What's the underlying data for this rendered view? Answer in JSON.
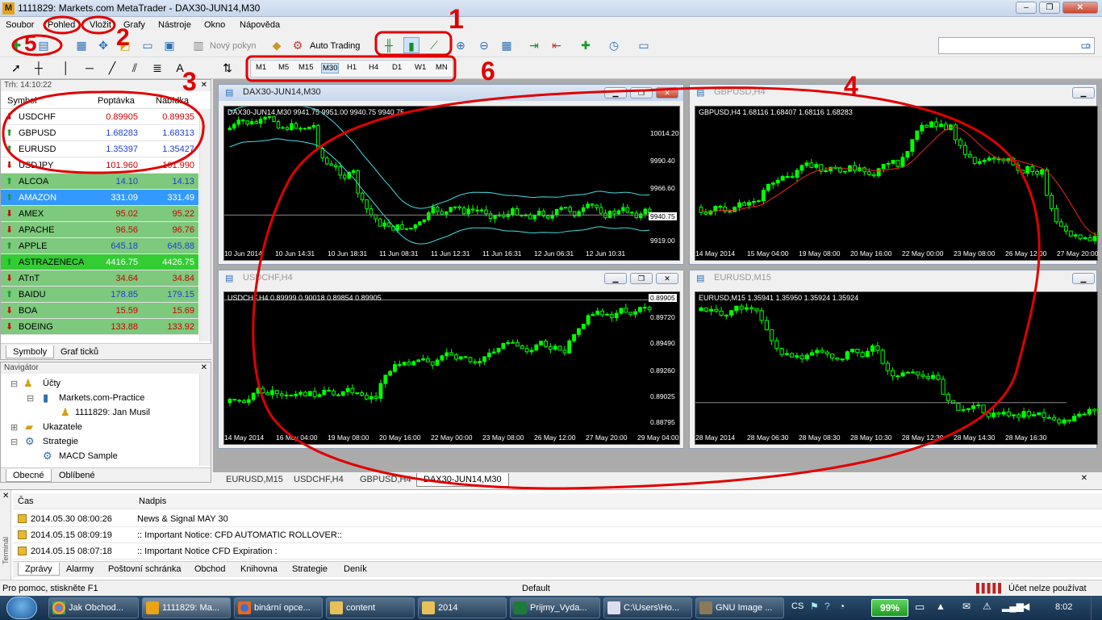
{
  "window": {
    "title": "1111829: Markets.com MetaTrader - DAX30-JUN14,M30",
    "icon_letter": "M"
  },
  "menu": [
    "Soubor",
    "Pohled",
    "Vložit",
    "Grafy",
    "Nástroje",
    "Okno",
    "Nápověda"
  ],
  "toolbar": {
    "new_order": "Nový pokyn",
    "auto_trading": "Auto Trading"
  },
  "timeframes": [
    "M1",
    "M5",
    "M15",
    "M30",
    "H1",
    "H4",
    "D1",
    "W1",
    "MN"
  ],
  "annotations": [
    "1",
    "2",
    "3",
    "4",
    "5",
    "6"
  ],
  "market_watch": {
    "header": "Trh: 14:10:22",
    "columns": {
      "symbol": "Symbol",
      "bid": "Poptávka",
      "ask": "Nabídka"
    },
    "rows": [
      {
        "symbol": "USDCHF",
        "bid": "0.89905",
        "ask": "0.89935",
        "dir": "down"
      },
      {
        "symbol": "GBPUSD",
        "bid": "1.68283",
        "ask": "1.68313",
        "dir": "up"
      },
      {
        "symbol": "EURUSD",
        "bid": "1.35397",
        "ask": "1.35427",
        "dir": "up"
      },
      {
        "symbol": "USDJPY",
        "bid": "101.960",
        "ask": "101.990",
        "dir": "down"
      },
      {
        "symbol": "ALCOA",
        "bid": "14.10",
        "ask": "14.13",
        "dir": "up"
      },
      {
        "symbol": "AMAZON",
        "bid": "331.09",
        "ask": "331.49",
        "dir": "up"
      },
      {
        "symbol": "AMEX",
        "bid": "95.02",
        "ask": "95.22",
        "dir": "down"
      },
      {
        "symbol": "APACHE",
        "bid": "96.56",
        "ask": "96.76",
        "dir": "down"
      },
      {
        "symbol": "APPLE",
        "bid": "645.18",
        "ask": "645.88",
        "dir": "up"
      },
      {
        "symbol": "ASTRAZENECA",
        "bid": "4416.75",
        "ask": "4426.75",
        "dir": "up"
      },
      {
        "symbol": "ATnT",
        "bid": "34.64",
        "ask": "34.84",
        "dir": "down"
      },
      {
        "symbol": "BAIDU",
        "bid": "178.85",
        "ask": "179.15",
        "dir": "up"
      },
      {
        "symbol": "BOA",
        "bid": "15.59",
        "ask": "15.69",
        "dir": "down"
      },
      {
        "symbol": "BOEING",
        "bid": "133.88",
        "ask": "133.92",
        "dir": "down"
      }
    ],
    "tabs": [
      "Symboly",
      "Graf ticků"
    ]
  },
  "navigator": {
    "header": "Navigátor",
    "items": [
      "Účty",
      "Markets.com-Practice",
      "1111829: Jan Musil",
      "Ukazatele",
      "Strategie",
      "MACD Sample"
    ],
    "tabs": [
      "Obecné",
      "Oblíbené"
    ]
  },
  "charts": {
    "dax": {
      "title": "DAX30-JUN14,M30",
      "info": "DAX30-JUN14,M30  9941.75 9951.00 9940.75 9940.75",
      "prices": [
        "10014.20",
        "9990.40",
        "9966.60",
        "9940.75",
        "9919.00"
      ],
      "times": [
        "10 Jun 2014",
        "10 Jun 14:31",
        "10 Jun 18:31",
        "11 Jun 08:31",
        "11 Jun 12:31",
        "11 Jun 16:31",
        "12 Jun 06:31",
        "12 Jun 10:31"
      ]
    },
    "gbpusd": {
      "title": "GBPUSD,H4",
      "info": "GBPUSD,H4  1.68116 1.68407 1.68116 1.68283",
      "times": [
        "14 May 2014",
        "15 May 04:00",
        "19 May 08:00",
        "20 May 16:00",
        "22 May 00:00",
        "23 May 08:00",
        "26 May 12:00",
        "27 May 20:00"
      ]
    },
    "usdchf": {
      "title": "USDCHF,H4",
      "info": "USDCHF,H4  0.89999 0.90018 0.89854 0.89905",
      "prices": [
        "0.89905",
        "0.89720",
        "0.89490",
        "0.89260",
        "0.89025",
        "0.88795"
      ],
      "times": [
        "14 May 2014",
        "16 May 04:00",
        "19 May 08:00",
        "20 May 16:00",
        "22 May 00:00",
        "23 May 08:00",
        "26 May 12:00",
        "27 May 20:00",
        "29 May 04:00"
      ]
    },
    "eurusd": {
      "title": "EURUSD,M15",
      "info": "EURUSD,M15  1.35941 1.35950 1.35924 1.35924",
      "times": [
        "28 May 2014",
        "28 May 06:30",
        "28 May 08:30",
        "28 May 10:30",
        "28 May 12:30",
        "28 May 14:30",
        "28 May 16:30"
      ]
    }
  },
  "chart_tabs": [
    "EURUSD,M15",
    "USDCHF,H4",
    "GBPUSD,H4",
    "DAX30-JUN14,M30"
  ],
  "terminal": {
    "columns": {
      "time": "Čas",
      "title": "Nadpis"
    },
    "rows": [
      {
        "time": "2014.05.30 08:00:26",
        "title": "News & Signal MAY 30"
      },
      {
        "time": "2014.05.15 08:09:19",
        "title": ":: Important Notice: CFD AUTOMATIC ROLLOVER::"
      },
      {
        "time": "2014.05.15 08:07:18",
        "title": ":: Important Notice CFD Expiration :"
      }
    ],
    "side_label": "Terminál",
    "tabs": [
      "Zprávy",
      "Alarmy",
      "Poštovní schránka",
      "Obchod",
      "Knihovna",
      "Strategie",
      "Deník"
    ]
  },
  "status": {
    "help": "Pro pomoc, stiskněte F1",
    "profile": "Default",
    "account": "Účet nelze používat"
  },
  "taskbar": {
    "items": [
      "Jak Obchod...",
      "1111829: Ma...",
      "binární opce...",
      "content",
      "2014",
      "Prijmy_Vyda...",
      "C:\\Users\\Ho...",
      "GNU Image ..."
    ],
    "lang": "CS",
    "battery": "99%",
    "clock": "8:02"
  }
}
